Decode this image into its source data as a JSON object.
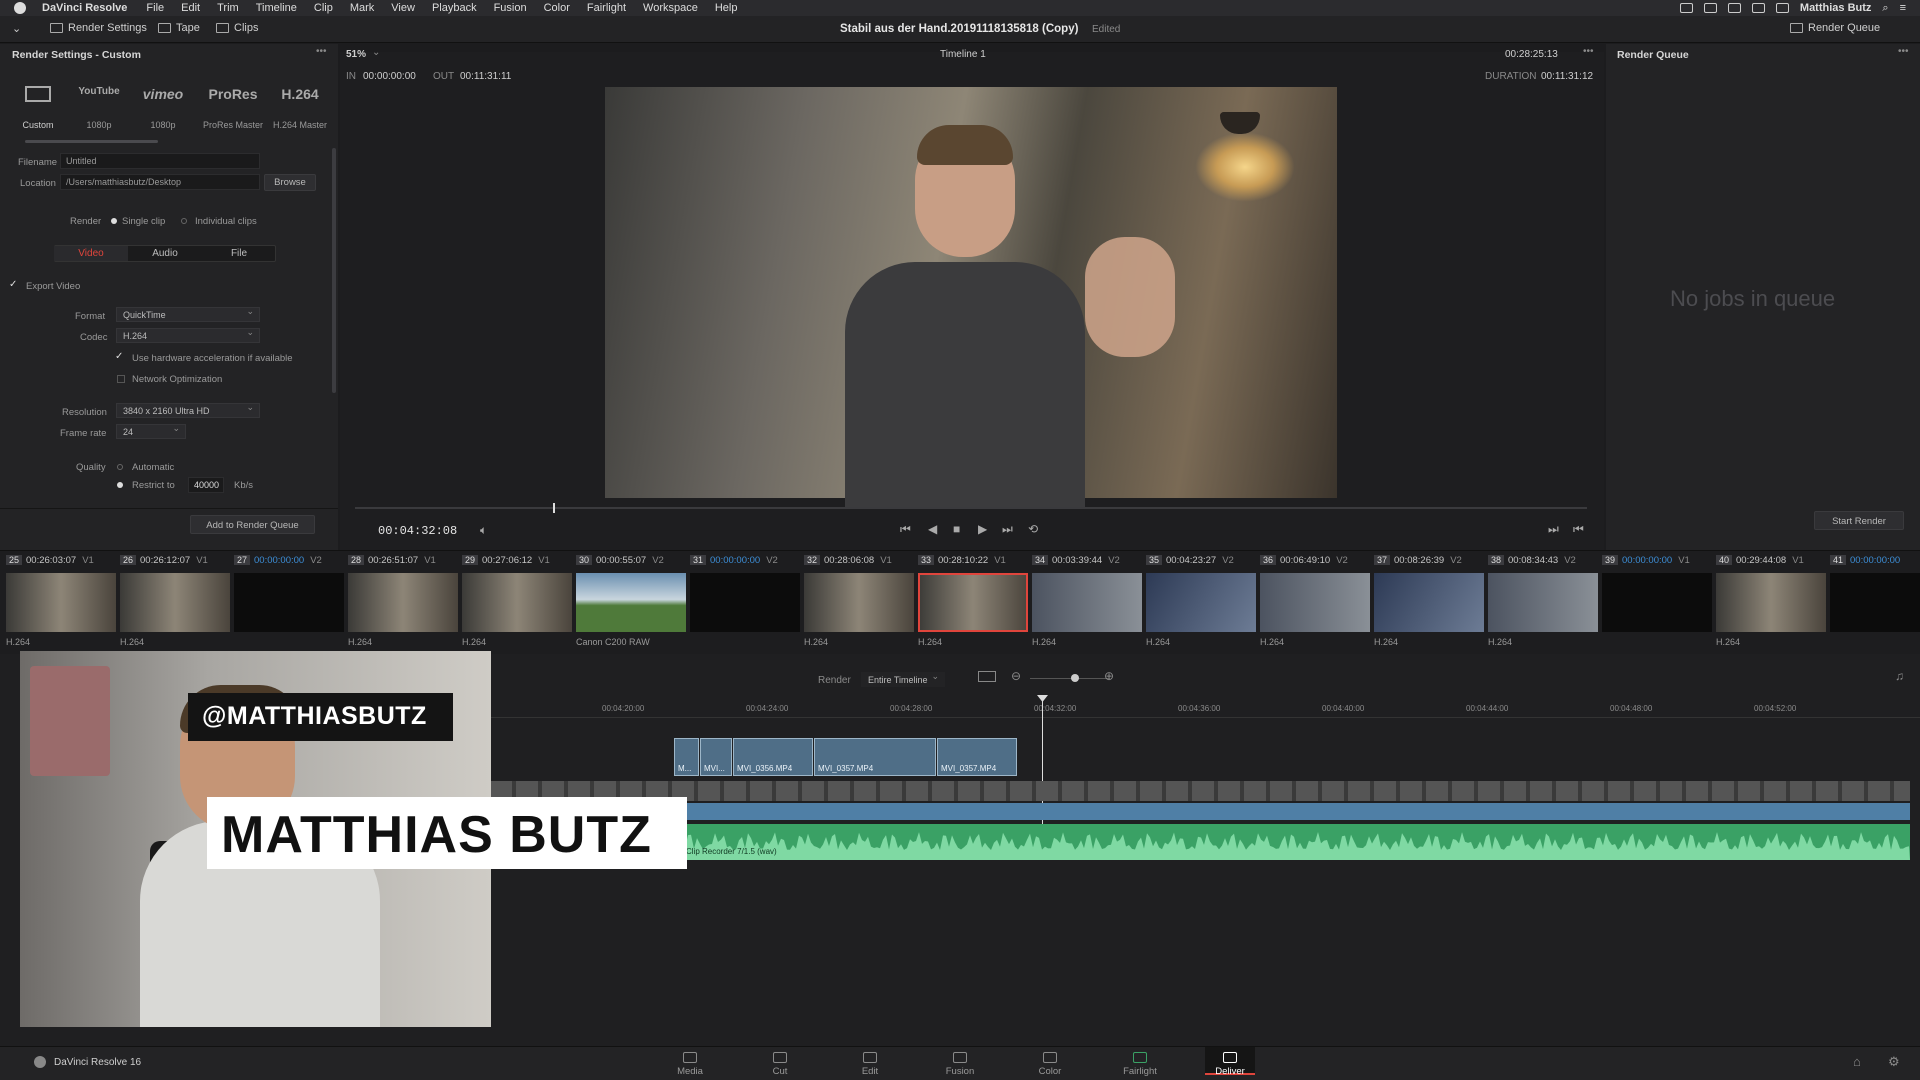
{
  "menubar": {
    "app_name": "DaVinci Resolve",
    "items": [
      "File",
      "Edit",
      "Trim",
      "Timeline",
      "Clip",
      "Mark",
      "View",
      "Playback",
      "Fusion",
      "Color",
      "Fairlight",
      "Workspace",
      "Help"
    ],
    "user": "Matthias Butz"
  },
  "toolbar": {
    "render_settings": "Render Settings",
    "tape": "Tape",
    "clips": "Clips",
    "project_title": "Stabil aus der Hand.20191118135818 (Copy)",
    "edited": "Edited",
    "render_queue": "Render Queue"
  },
  "render_settings": {
    "title": "Render Settings - Custom",
    "presets": [
      {
        "name": "",
        "caption": "Custom"
      },
      {
        "name": "YouTube",
        "caption": "1080p"
      },
      {
        "name": "vimeo",
        "caption": "1080p"
      },
      {
        "name": "ProRes",
        "caption": "ProRes Master"
      },
      {
        "name": "H.264",
        "caption": "H.264 Master"
      }
    ],
    "filename_label": "Filename",
    "filename_value": "Untitled",
    "location_label": "Location",
    "location_value": "/Users/matthiasbutz/Desktop",
    "browse": "Browse",
    "render_label": "Render",
    "single_clip": "Single clip",
    "individual_clips": "Individual clips",
    "tabs": [
      "Video",
      "Audio",
      "File"
    ],
    "export_video": "Export Video",
    "format_label": "Format",
    "format_value": "QuickTime",
    "codec_label": "Codec",
    "codec_value": "H.264",
    "hw_accel": "Use hardware acceleration if available",
    "network_opt": "Network Optimization",
    "resolution_label": "Resolution",
    "resolution_value": "3840 x 2160 Ultra HD",
    "framerate_label": "Frame rate",
    "framerate_value": "24",
    "quality_label": "Quality",
    "automatic": "Automatic",
    "restrict_to": "Restrict to",
    "restrict_value": "40000",
    "kbs": "Kb/s",
    "add_to_queue": "Add to Render Queue"
  },
  "viewer": {
    "zoom": "51%",
    "timeline_name": "Timeline 1",
    "timecode_top": "00:28:25:13",
    "in_label": "IN",
    "in_tc": "00:00:00:00",
    "out_label": "OUT",
    "out_tc": "00:11:31:11",
    "duration_label": "DURATION",
    "duration_tc": "00:11:31:12",
    "current_tc": "00:04:32:08"
  },
  "render_queue": {
    "title": "Render Queue",
    "empty": "No jobs in queue",
    "start": "Start Render"
  },
  "clips": [
    {
      "num": "25",
      "tc": "00:26:03:07",
      "track": "V1",
      "codec": "H.264"
    },
    {
      "num": "26",
      "tc": "00:26:12:07",
      "track": "V1",
      "codec": "H.264"
    },
    {
      "num": "27",
      "tc": "00:00:00:00",
      "track": "V2",
      "codec": ""
    },
    {
      "num": "28",
      "tc": "00:26:51:07",
      "track": "V1",
      "codec": "H.264"
    },
    {
      "num": "29",
      "tc": "00:27:06:12",
      "track": "V1",
      "codec": "H.264"
    },
    {
      "num": "30",
      "tc": "00:00:55:07",
      "track": "V2",
      "codec": "Canon C200 RAW"
    },
    {
      "num": "31",
      "tc": "00:00:00:00",
      "track": "V2",
      "codec": ""
    },
    {
      "num": "32",
      "tc": "00:28:06:08",
      "track": "V1",
      "codec": "H.264"
    },
    {
      "num": "33",
      "tc": "00:28:10:22",
      "track": "V1",
      "codec": "H.264"
    },
    {
      "num": "34",
      "tc": "00:03:39:44",
      "track": "V2",
      "codec": "H.264"
    },
    {
      "num": "35",
      "tc": "00:04:23:27",
      "track": "V2",
      "codec": "H.264"
    },
    {
      "num": "36",
      "tc": "00:06:49:10",
      "track": "V2",
      "codec": "H.264"
    },
    {
      "num": "37",
      "tc": "00:08:26:39",
      "track": "V2",
      "codec": "H.264"
    },
    {
      "num": "38",
      "tc": "00:08:34:43",
      "track": "V2",
      "codec": "H.264"
    },
    {
      "num": "39",
      "tc": "00:00:00:00",
      "track": "V1",
      "codec": ""
    },
    {
      "num": "40",
      "tc": "00:29:44:08",
      "track": "V1",
      "codec": "H.264"
    },
    {
      "num": "41",
      "tc": "00:00:00:00",
      "track": "",
      "codec": ""
    }
  ],
  "timeline": {
    "render_label": "Render",
    "render_value": "Entire Timeline",
    "ruler": [
      "00:04:20:00",
      "00:04:24:00",
      "00:04:28:00",
      "00:04:32:00",
      "00:04:36:00",
      "00:04:40:00",
      "00:04:44:00",
      "00:04:48:00",
      "00:04:52:00"
    ],
    "video_clips": [
      "M...",
      "MVI...",
      "MVI_0356.MP4",
      "MVI_0357.MP4",
      "MVI_0357.MP4"
    ],
    "audio_clip": "Clip Recorder 7/1.5 (wav)"
  },
  "overlay": {
    "handle": "@MATTHIASBUTZ",
    "name": "MATTHIAS BUTZ"
  },
  "bottombar": {
    "product": "DaVinci Resolve 16",
    "pages": [
      "Media",
      "Cut",
      "Edit",
      "Fusion",
      "Color",
      "Fairlight",
      "Deliver"
    ]
  },
  "colors": {
    "accent_red": "#e0453c",
    "timecode_blue": "#3d8fd8",
    "audio_green": "#3aa165"
  }
}
